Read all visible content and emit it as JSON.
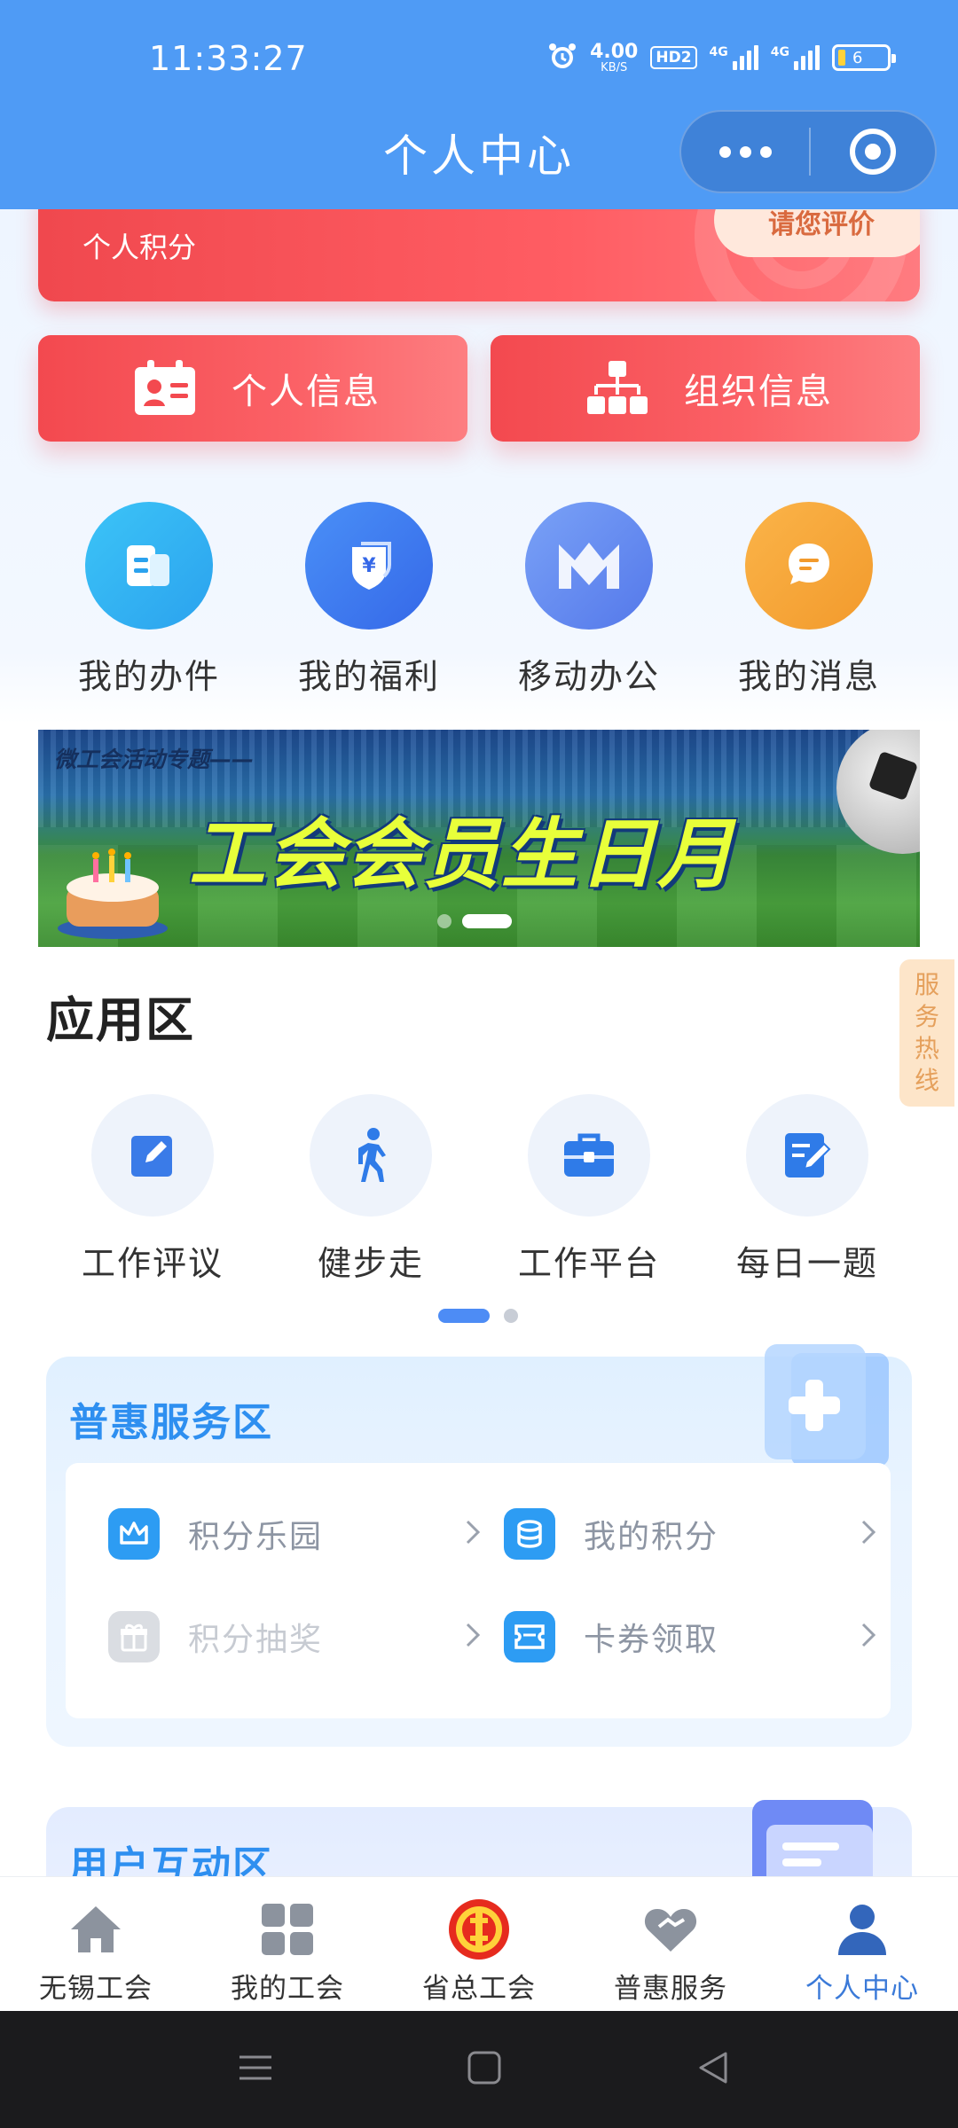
{
  "status_bar": {
    "time": "11:33:27",
    "net_speed_value": "4.00",
    "net_speed_unit": "KB/S",
    "hd_badge": "HD2",
    "signal1_label": "4G",
    "signal2_label": "4G",
    "battery_level": "6",
    "icons": [
      "alarm-icon",
      "signal-icon",
      "battery-icon"
    ]
  },
  "nav": {
    "title": "个人中心",
    "capsule_icons": [
      "more-icon",
      "close-mini-program-icon"
    ]
  },
  "points_card": {
    "label": "个人积分",
    "rate_button": "请您评价"
  },
  "info_buttons": [
    {
      "label": "个人信息",
      "icon": "id-card-icon"
    },
    {
      "label": "组织信息",
      "icon": "org-chart-icon"
    }
  ],
  "quick_actions": [
    {
      "label": "我的办件",
      "icon": "document-icon",
      "color": "#2fb2f2"
    },
    {
      "label": "我的福利",
      "icon": "welfare-shield-icon",
      "color": "#3f7cf0"
    },
    {
      "label": "移动办公",
      "icon": "mobile-office-icon",
      "color": "#5f8cf2"
    },
    {
      "label": "我的消息",
      "icon": "message-icon",
      "color": "#f6a43b"
    }
  ],
  "banner": {
    "subtitle": "微工会活动专题——",
    "title": "工会会员生日月",
    "slide_total": 2,
    "slide_active": 2
  },
  "side_hotline": [
    "服",
    "务",
    "热",
    "线"
  ],
  "app_section": {
    "title": "应用区",
    "apps": [
      {
        "label": "工作评议",
        "icon": "edit-icon"
      },
      {
        "label": "健步走",
        "icon": "walking-icon"
      },
      {
        "label": "工作平台",
        "icon": "briefcase-icon"
      },
      {
        "label": "每日一题",
        "icon": "quiz-icon"
      }
    ],
    "page_total": 2,
    "page_active": 1
  },
  "benefit_section": {
    "title": "普惠服务区",
    "items": [
      {
        "label": "积分乐园",
        "icon": "crown-icon",
        "enabled": true
      },
      {
        "label": "我的积分",
        "icon": "coins-icon",
        "enabled": true
      },
      {
        "label": "积分抽奖",
        "icon": "gift-icon",
        "enabled": false
      },
      {
        "label": "卡券领取",
        "icon": "coupon-icon",
        "enabled": true
      }
    ]
  },
  "interact_section": {
    "title": "用户互动区"
  },
  "tabbar": {
    "active_index": 4,
    "active_color": "#3b7ad8",
    "items": [
      {
        "label": "无锡工会",
        "icon": "home-icon"
      },
      {
        "label": "我的工会",
        "icon": "grid-icon"
      },
      {
        "label": "省总工会",
        "icon": "union-emblem-icon"
      },
      {
        "label": "普惠服务",
        "icon": "heart-icon"
      },
      {
        "label": "个人中心",
        "icon": "person-icon"
      }
    ]
  },
  "system_nav": [
    "menu-icon",
    "home-square-icon",
    "back-icon"
  ],
  "colors": {
    "primary_blue": "#4f9bf5",
    "card_red": "#f3494f",
    "section_title_blue": "#2e8ff0"
  }
}
